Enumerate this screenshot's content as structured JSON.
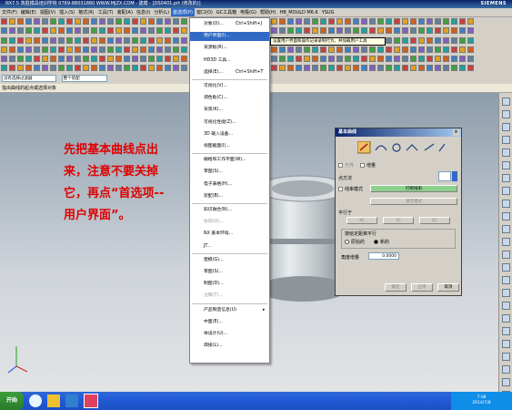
{
  "window": {
    "title": "NX7.5  筑胜模具培训学校  0769-88031880  WWW.MJZX.COM - 建模 - [DS0401.prt  (修改的)]",
    "brand": "SIEMENS"
  },
  "menubar": {
    "items": [
      "文件(F)",
      "编辑(E)",
      "视图(V)",
      "插入(S)",
      "格式(R)",
      "工具(T)",
      "装配(A)",
      "信息(I)",
      "分析(L)",
      "首选项(P)",
      "窗口(O)",
      "GC工具箱",
      "电极(G)",
      "帮助(H)",
      "HB_MOULD M6.6",
      "YSUG"
    ],
    "active_index": 9
  },
  "selection_bar": {
    "filter_value": "没有选择过滤器",
    "scope_value": "整个装配"
  },
  "status_text": "指出曲线的起点或选择对象",
  "instruction_note": {
    "lines": [
      "先把基本曲线点出",
      "来，注意不要关掉",
      "它，再点“首选项--",
      "用户界面”。"
    ],
    "color": "#e00000"
  },
  "menu": {
    "items": [
      {
        "label": "对象(O)...",
        "shortcut": "Ctrl+Shift+J",
        "state": "normal"
      },
      {
        "label": "用户界面(I)...",
        "shortcut": "",
        "state": "highlighted"
      },
      {
        "label": "资源板(R)...",
        "shortcut": "",
        "state": "normal"
      },
      {
        "label": "HD3D 工具...",
        "shortcut": "",
        "state": "normal"
      },
      {
        "label": "选择(E)...",
        "shortcut": "Ctrl+Shift+T",
        "state": "normal"
      },
      {
        "label": "可视化(V)...",
        "shortcut": "",
        "state": "normal"
      },
      {
        "label": "调色板(C)...",
        "shortcut": "",
        "state": "normal"
      },
      {
        "label": "背景(K)...",
        "shortcut": "",
        "state": "normal"
      },
      {
        "label": "可视化性能(Z)...",
        "shortcut": "",
        "state": "normal"
      },
      {
        "label": "3D 输入设备...",
        "shortcut": "",
        "state": "normal"
      },
      {
        "label": "视图截面(I)...",
        "shortcut": "",
        "state": "normal"
      },
      {
        "label": "栅格和工作平面(W)...",
        "shortcut": "",
        "state": "normal"
      },
      {
        "label": "草图(S)...",
        "shortcut": "",
        "state": "normal"
      },
      {
        "label": "电子表格(H)...",
        "shortcut": "",
        "state": "normal"
      },
      {
        "label": "装配(B)...",
        "shortcut": "",
        "state": "normal"
      },
      {
        "label": "知识融合(N)...",
        "shortcut": "",
        "state": "normal"
      },
      {
        "label": "协同(O)...",
        "shortcut": "",
        "state": "disabled"
      },
      {
        "label": "NX 基本环境...",
        "shortcut": "",
        "state": "normal"
      },
      {
        "label": "JT...",
        "shortcut": "",
        "state": "normal"
      },
      {
        "label": "建模(G)...",
        "shortcut": "",
        "state": "normal"
      },
      {
        "label": "草图(S)...",
        "shortcut": "",
        "state": "normal"
      },
      {
        "label": "制图(D)...",
        "shortcut": "",
        "state": "normal"
      },
      {
        "label": "注释(T)...",
        "shortcut": "",
        "state": "disabled"
      },
      {
        "label": "产品制造信息(U)",
        "shortcut": "",
        "state": "submenu"
      },
      {
        "label": "中面(E)...",
        "shortcut": "",
        "state": "normal"
      },
      {
        "label": "体设计(U)...",
        "shortcut": "",
        "state": "normal"
      },
      {
        "label": "焊接(L)...",
        "shortcut": "",
        "state": "normal"
      }
    ]
  },
  "tooltip": "设置用户界面和操作记录录制行为，并加载用户工具",
  "dialog": {
    "title": "基本曲线",
    "checkbox_unbounded": "无界",
    "checkbox_increment": "增量",
    "point_method_label": "点方法",
    "string_mode_label": "线串模式",
    "break_string_button": "打断线串",
    "lock_mode_button": "锁定模式",
    "parallel_to_label": "平行于",
    "xc": "XC",
    "yc": "YC",
    "zc": "ZC",
    "parallel_by_label": "按给定距离平行",
    "radio_original": "原始的",
    "radio_new": "新的",
    "angle_increment_label": "角度增量",
    "angle_increment_value": "0.0000",
    "ok_button": "确定",
    "apply_button": "应用",
    "cancel_button": "取消"
  },
  "taskbar": {
    "start_label": "开始",
    "time": "7:08",
    "date": "2014/7/8"
  }
}
